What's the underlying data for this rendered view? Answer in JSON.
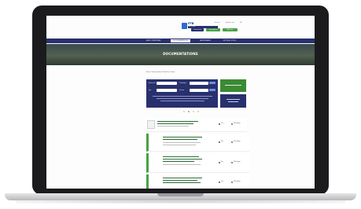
{
  "header": {
    "logo_primary": "FFB",
    "logo_secondary": "ECTIONS",
    "logo_tagline": "",
    "top_links": [
      "Contact",
      "Espace pro",
      "FR"
    ],
    "buttons": [
      "Connexion",
      "Inscription",
      "Adhérer"
    ]
  },
  "nav": {
    "items": [
      "BIEN CONSTRUIRE",
      "DOCUMENTATIONS",
      "SAVOIR-FAIRE",
      "BOITE A OUTILS"
    ]
  },
  "hero": {
    "title": "DOCUMENTATIONS",
    "subtitle": ""
  },
  "breadcrumb": "Accueil  /  Documentations  /  Publications  /  Guides",
  "search": {
    "label_1": "Rechercher",
    "label_2": "Thématique",
    "label_3": "Type",
    "label_4": "Trier par",
    "note": ""
  },
  "promo": {
    "green_label": "",
    "navy_label": ""
  },
  "documents": [
    {
      "title": "",
      "desc": "",
      "meta": "",
      "action_1": "Voir",
      "action_2": "Télécharger"
    },
    {
      "title": "",
      "desc": "",
      "meta": "",
      "action_1": "Voir",
      "action_2": "Télécharger"
    },
    {
      "title": "",
      "desc": "",
      "meta": "",
      "action_1": "Voir",
      "action_2": "Télécharger"
    },
    {
      "title": "",
      "desc": "",
      "meta": "",
      "action_1": "Voir",
      "action_2": "Télécharger"
    }
  ],
  "colors": {
    "navy": "#28306e",
    "green": "#3b8a35",
    "laptop": "#1b1b1d"
  }
}
